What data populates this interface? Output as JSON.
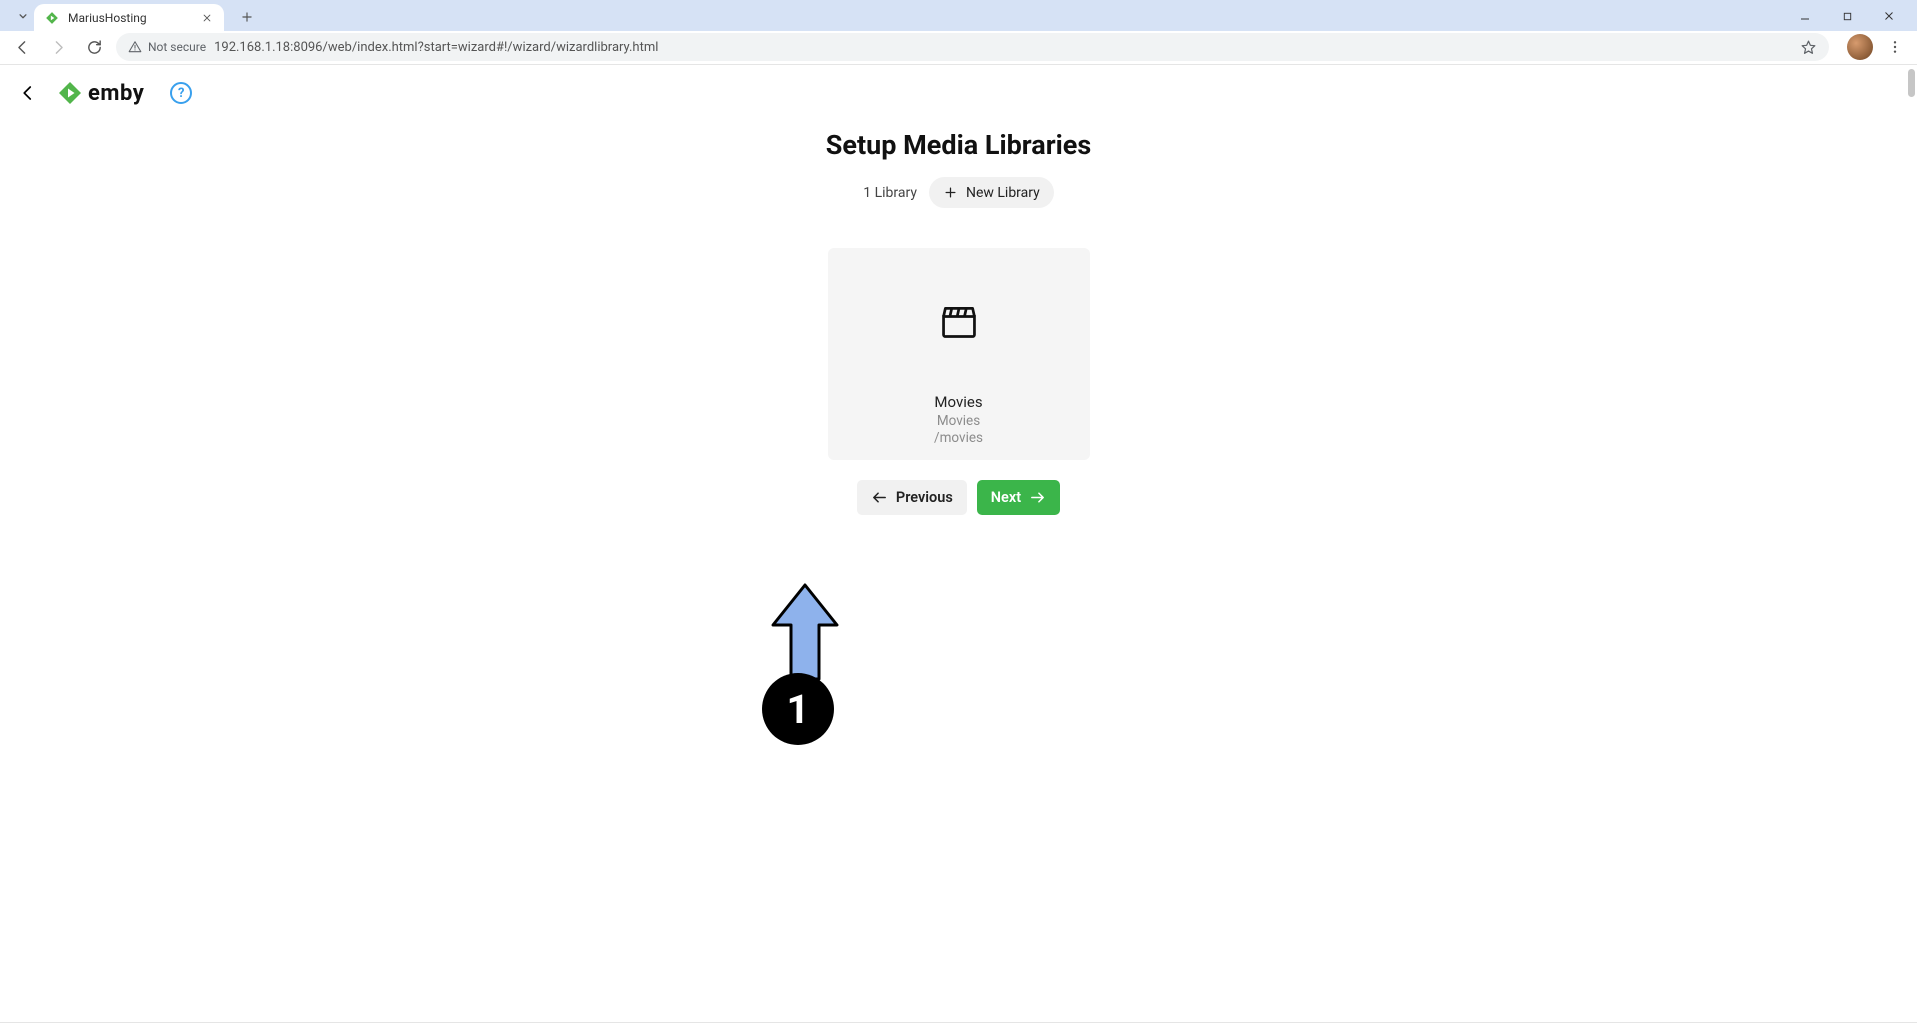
{
  "browser": {
    "tab_title": "MariusHosting",
    "url": "192.168.1.18:8096/web/index.html?start=wizard#!/wizard/wizardlibrary.html",
    "not_secure_label": "Not secure"
  },
  "app": {
    "brand": "emby"
  },
  "page": {
    "title": "Setup Media Libraries",
    "library_count_label": "1 Library",
    "new_library_label": "New Library",
    "library": {
      "name": "Movies",
      "type": "Movies",
      "path": "/movies"
    },
    "previous_label": "Previous",
    "next_label": "Next"
  },
  "annotation": {
    "step": "1"
  }
}
